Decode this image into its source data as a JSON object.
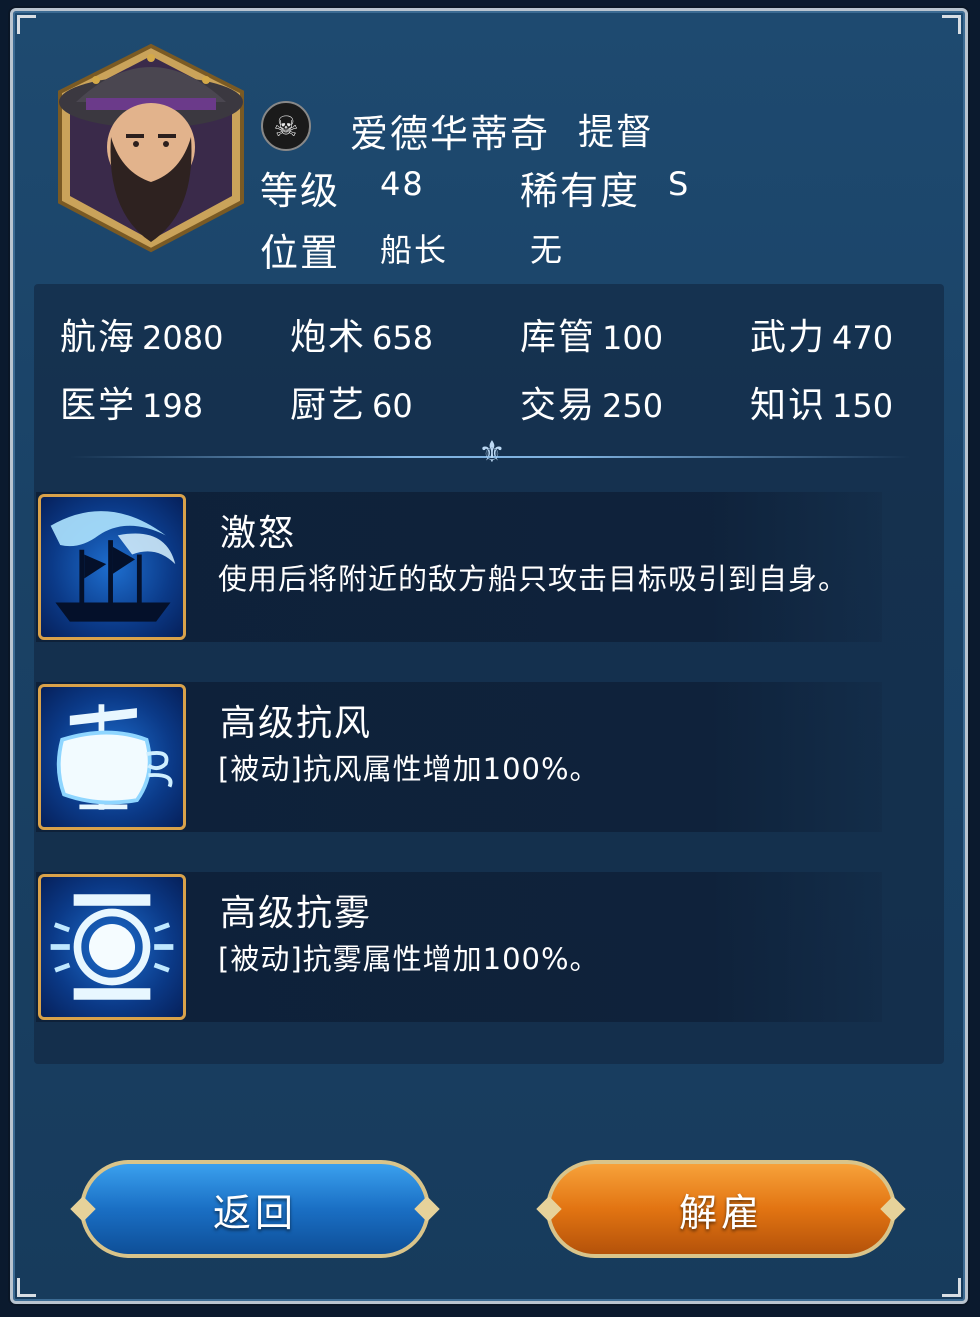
{
  "character": {
    "name": "爱德华蒂奇",
    "rank": "提督",
    "level_label": "等级",
    "level_value": "48",
    "rarity_label": "稀有度",
    "rarity_value": "S",
    "position_label": "位置",
    "position_value": "船长",
    "position_extra": "无",
    "icon": "skull-crossbones-icon"
  },
  "stats": [
    {
      "label": "航海",
      "value": "2080"
    },
    {
      "label": "炮术",
      "value": "658"
    },
    {
      "label": "库管",
      "value": "100"
    },
    {
      "label": "武力",
      "value": "470"
    },
    {
      "label": "医学",
      "value": "198"
    },
    {
      "label": "厨艺",
      "value": "60"
    },
    {
      "label": "交易",
      "value": "250"
    },
    {
      "label": "知识",
      "value": "150"
    }
  ],
  "skills": [
    {
      "title": "激怒",
      "desc": "使用后将附近的敌方船只攻击目标吸引到自身。",
      "icon": "rage-ship-icon"
    },
    {
      "title": "高级抗风",
      "desc": "[被动]抗风属性增加100%。",
      "icon": "wind-resist-icon"
    },
    {
      "title": "高级抗雾",
      "desc": "[被动]抗雾属性增加100%。",
      "icon": "fog-resist-icon"
    }
  ],
  "buttons": {
    "back": "返回",
    "dismiss": "解雇"
  },
  "colors": {
    "panel": "#1a4266",
    "back_button": "#1a6fc4",
    "dismiss_button": "#e27412",
    "icon_border": "#d9a24a"
  }
}
